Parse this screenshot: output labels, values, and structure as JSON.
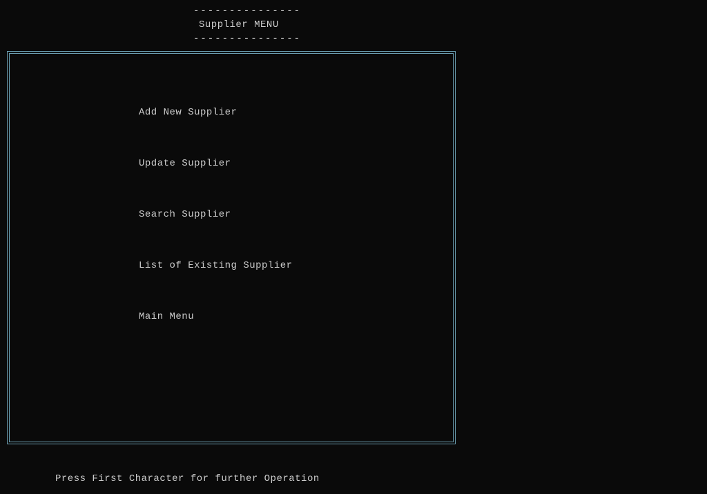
{
  "header": {
    "dashes": "---------------",
    "title": "Supplier MENU"
  },
  "menu": {
    "items": [
      "Add New Supplier",
      "Update Supplier",
      "Search Supplier",
      "List of Existing Supplier",
      "Main Menu"
    ]
  },
  "footer": {
    "hint": "Press First Character for further Operation"
  }
}
